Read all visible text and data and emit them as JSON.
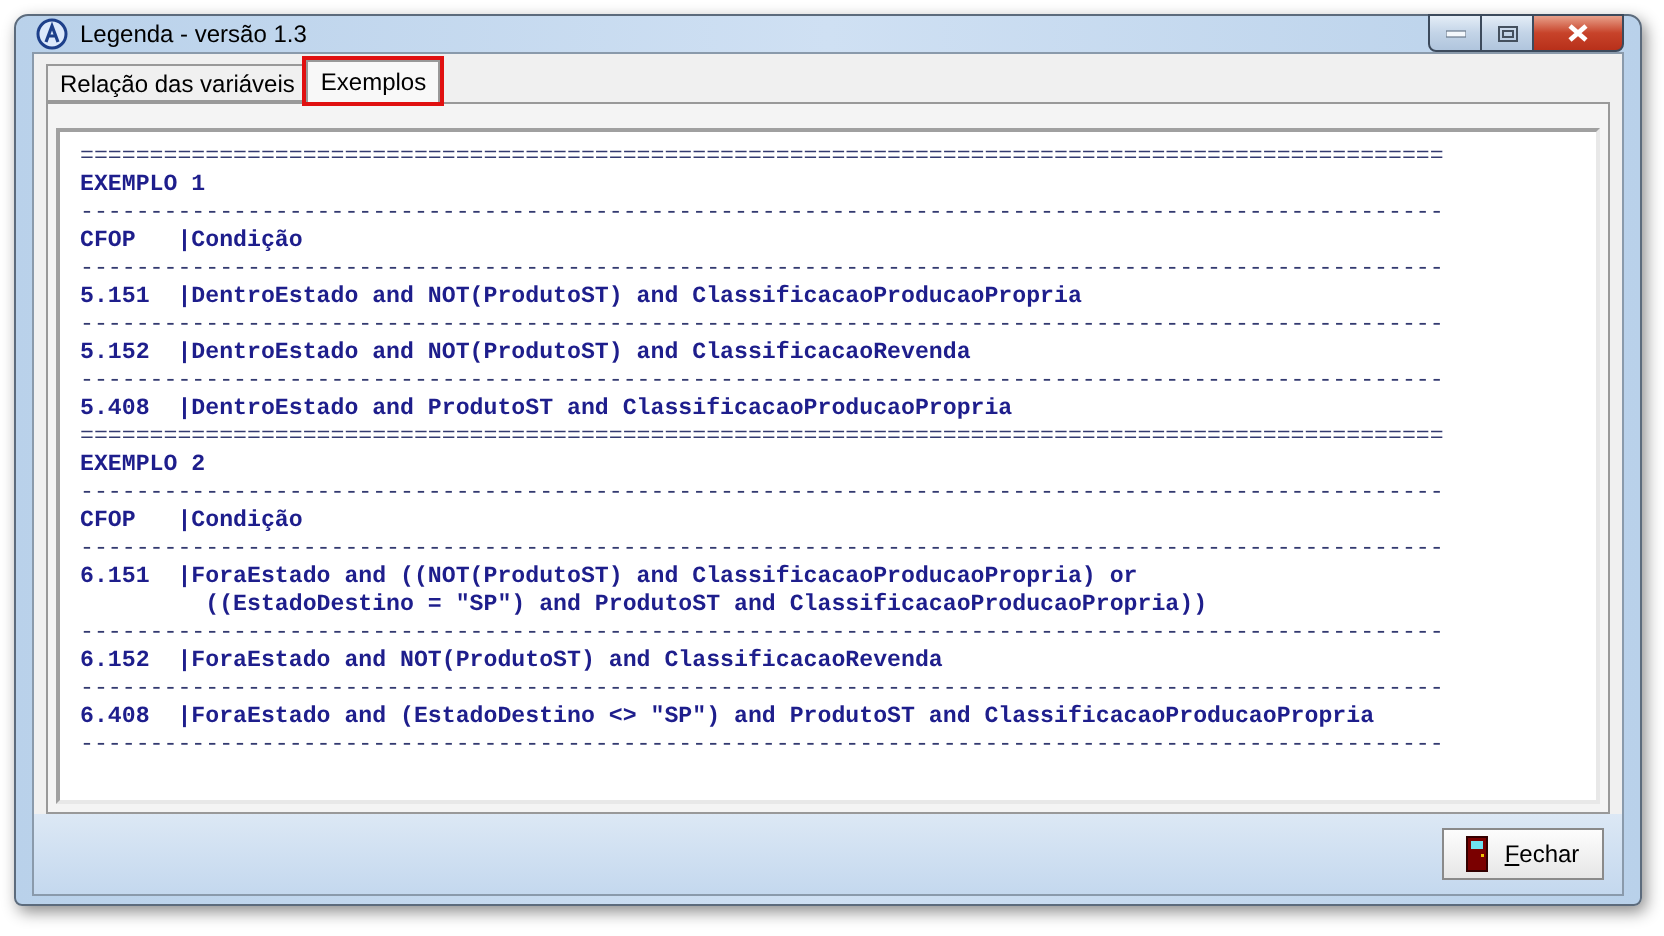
{
  "window": {
    "title": "Legenda - versão 1.3"
  },
  "tabs": [
    {
      "label": "Relação das variáveis",
      "selected": false
    },
    {
      "label": "Exemplos",
      "selected": true
    }
  ],
  "memo": {
    "lines": [
      "==================================================================================================",
      "EXEMPLO 1",
      "--------------------------------------------------------------------------------------------------",
      "CFOP   |Condição",
      "--------------------------------------------------------------------------------------------------",
      "5.151  |DentroEstado and NOT(ProdutoST) and ClassificacaoProducaoPropria",
      "--------------------------------------------------------------------------------------------------",
      "5.152  |DentroEstado and NOT(ProdutoST) and ClassificacaoRevenda",
      "--------------------------------------------------------------------------------------------------",
      "5.408  |DentroEstado and ProdutoST and ClassificacaoProducaoPropria",
      "==================================================================================================",
      "EXEMPLO 2",
      "--------------------------------------------------------------------------------------------------",
      "CFOP   |Condição",
      "--------------------------------------------------------------------------------------------------",
      "6.151  |ForaEstado and ((NOT(ProdutoST) and ClassificacaoProducaoPropria) or",
      "         ((EstadoDestino = \"SP\") and ProdutoST and ClassificacaoProducaoPropria))",
      "--------------------------------------------------------------------------------------------------",
      "6.152  |ForaEstado and NOT(ProdutoST) and ClassificacaoRevenda",
      "--------------------------------------------------------------------------------------------------",
      "6.408  |ForaEstado and (EstadoDestino <> \"SP\") and ProdutoST and ClassificacaoProducaoPropria",
      "--------------------------------------------------------------------------------------------------"
    ]
  },
  "buttons": [
    {
      "label": "Fechar"
    }
  ]
}
